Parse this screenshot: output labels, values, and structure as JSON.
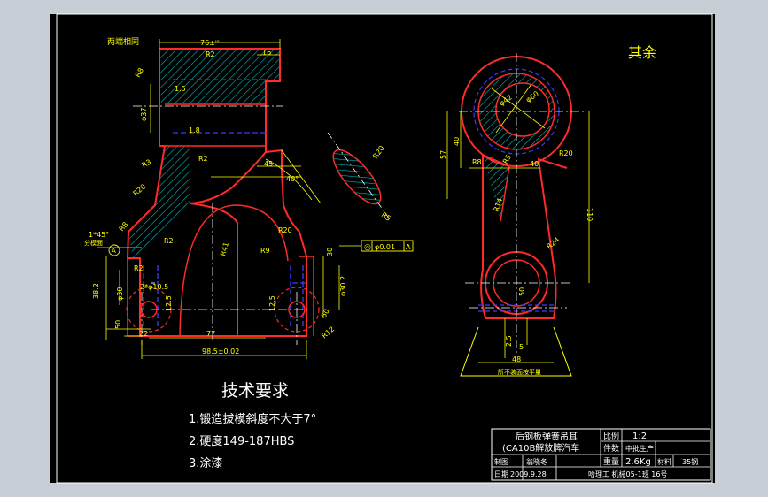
{
  "annotations": {
    "two_ends_same": "两端相同",
    "remainder": "其余",
    "parting_line": "分模面",
    "unmachined_end": "所不装面按平量"
  },
  "dimensions": {
    "d76": "76±ⁱ⁹",
    "d16": "16",
    "d15": "1.5",
    "d18": "1.8",
    "r2a": "R2",
    "r2b": "R2",
    "r2c": "R2",
    "r8a": "R8",
    "r8b": "R8",
    "r3": "R3",
    "r20a": "R20",
    "r20b": "R20",
    "r20c": "R20",
    "r41": "R41",
    "r9": "R9",
    "r5a": "R5",
    "r5b": "R5",
    "r12": "R12",
    "r24": "R24",
    "r14": "R14",
    "d45": "45",
    "d40deg": "40°",
    "d30": "30",
    "d50a": "50",
    "d50b": "50",
    "d50c": "50",
    "d22": "22",
    "d125": "12.5",
    "d77": "77",
    "d985": "98.5±0.02",
    "d382": "38.2",
    "dia30": "φ30",
    "dia302": "φ30.2",
    "dia37": "φ37",
    "dia105": "2*φ10.5",
    "chamfer": "1*45°",
    "dia42": "φ42",
    "dia60": "φ60",
    "d57": "57",
    "d40": "40",
    "d40b": "40",
    "d110": "110",
    "d48": "48",
    "d16b": "16",
    "d5": "5",
    "d25": "2.5",
    "tol_symbol": "◎",
    "tol_value": "φ0.01",
    "tol_datum": "A",
    "datum_a": "A"
  },
  "requirements": {
    "heading": "技术要求",
    "items": [
      "1.锻造拔模斜度不大于7°",
      "2.硬度149-187HBS",
      "3.涂漆"
    ]
  },
  "title_block": {
    "part_name_line1": "后钢板弹簧吊耳",
    "part_name_line2": "(CA10B解放牌汽车",
    "scale_label": "比例",
    "scale_value": "1:2",
    "quantity_label": "件数",
    "quantity_value": "中批生产",
    "drawn_label": "制图",
    "drawn_value": "翁晓冬",
    "weight_label": "重量",
    "weight_value": "2.6Kg",
    "material_label": "材料",
    "material_value": "35钢",
    "date_label": "日期",
    "date_value": "2009.9.28",
    "school": "哈理工  机械05-1班 16号"
  },
  "colors": {
    "background_outer": "#c7ced6",
    "sheet": "#000000",
    "border": "#ffffff",
    "outline": "#ff2a2a",
    "dimension": "#ffff00",
    "centerline": "#ffffff",
    "hidden": "#3a3aff",
    "hatch": "#00c0c0",
    "title_text": "#ffffff"
  }
}
